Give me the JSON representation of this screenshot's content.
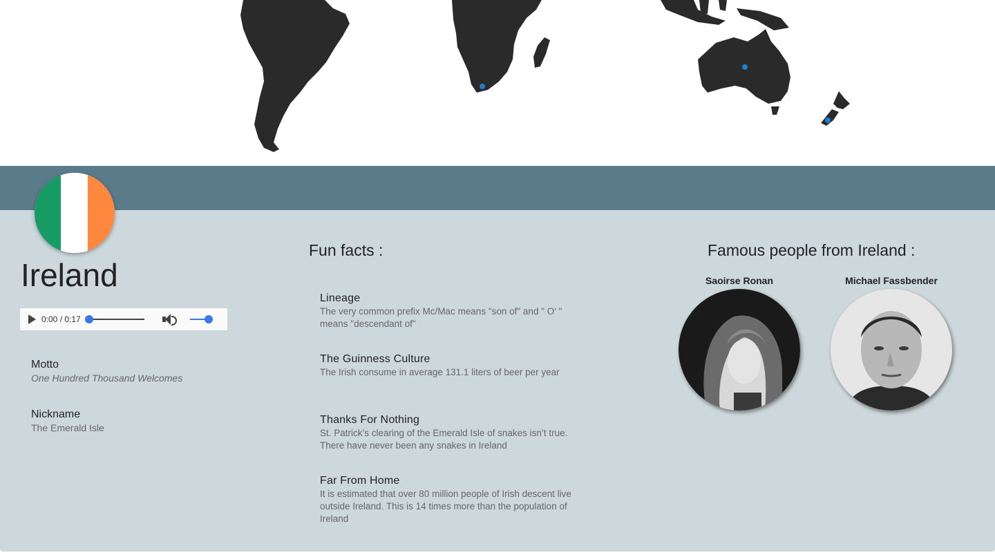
{
  "map": {
    "markers": [
      {
        "name": "south-africa-marker",
        "color": "#1a7fd1"
      },
      {
        "name": "australia-marker",
        "color": "#1a7fd1"
      },
      {
        "name": "new-zealand-marker",
        "color": "#1a7fd1"
      }
    ],
    "land_color": "#2a2a2a"
  },
  "country": {
    "name": "Ireland",
    "flag_colors": [
      "#169b62",
      "#ffffff",
      "#ff883e"
    ]
  },
  "audio": {
    "time": "0:00 / 0:17",
    "progress": 0,
    "volume": 1.0
  },
  "info": {
    "motto_label": "Motto",
    "motto_value": "One Hundred Thousand Welcomes",
    "nickname_label": "Nickname",
    "nickname_value": "The Emerald Isle"
  },
  "fun_facts": {
    "title": "Fun facts :",
    "items": [
      {
        "title": "Lineage",
        "text": "The very common prefix Mc/Mac means \"son of\" and \" O' \" means \"descendant of\""
      },
      {
        "title": "The Guinness Culture",
        "text": "The Irish consume in average 131.1 liters of beer per year"
      },
      {
        "title": "Thanks For Nothing",
        "text": "St. Patrick’s clearing of the Emerald Isle of snakes isn’t true. There have never been any snakes in Ireland"
      },
      {
        "title": "Far From Home",
        "text": "It is estimated that over 80 million people of Irish descent live outside Ireland. This is 14 times more than the population of Ireland"
      }
    ]
  },
  "famous": {
    "title": "Famous people from Ireland :",
    "people": [
      {
        "name": "Saoirse Ronan"
      },
      {
        "name": "Michael Fassbender"
      }
    ]
  },
  "colors": {
    "band": "#5a7b8a",
    "panel": "#cdd8dc",
    "accent": "#3b78e7"
  }
}
